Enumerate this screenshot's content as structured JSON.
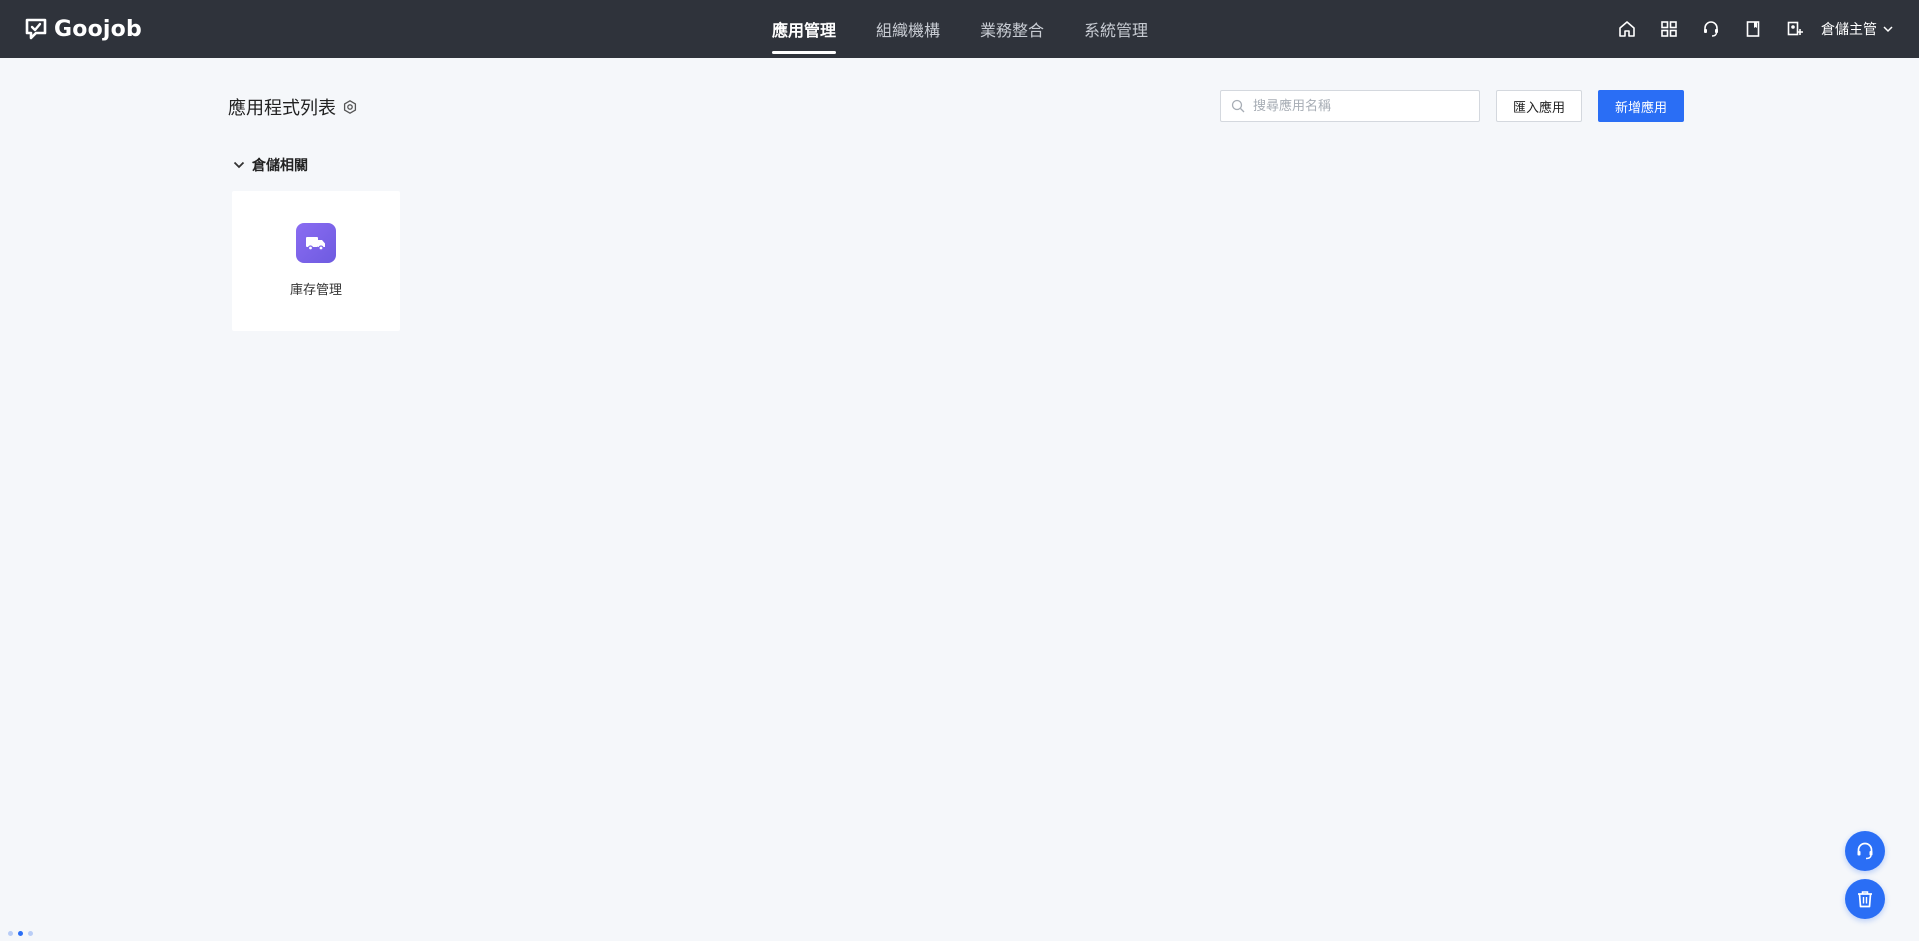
{
  "brand": {
    "logo_text": "Goojob",
    "logo_icon": "chat-check-logo"
  },
  "nav": {
    "items": [
      {
        "label": "應用管理",
        "active": true
      },
      {
        "label": "組織機構",
        "active": false
      },
      {
        "label": "業務整合",
        "active": false
      },
      {
        "label": "系統管理",
        "active": false
      }
    ]
  },
  "toolbar": {
    "icons": [
      "home-icon",
      "apps-grid-icon",
      "support-headset-icon",
      "book-icon",
      "add-user-icon"
    ],
    "user_label": "倉儲主管"
  },
  "page": {
    "title": "應用程式列表",
    "search_placeholder": "搜尋應用名稱",
    "import_button": "匯入應用",
    "new_button": "新增應用"
  },
  "groups": [
    {
      "title": "倉儲相關",
      "expanded": true,
      "apps": [
        {
          "name": "庫存管理",
          "icon": "truck-icon",
          "color": "#7c63ea"
        }
      ]
    }
  ],
  "colors": {
    "topbar": "#2f333b",
    "primary": "#2a6ef5",
    "background": "#f5f7fa"
  }
}
